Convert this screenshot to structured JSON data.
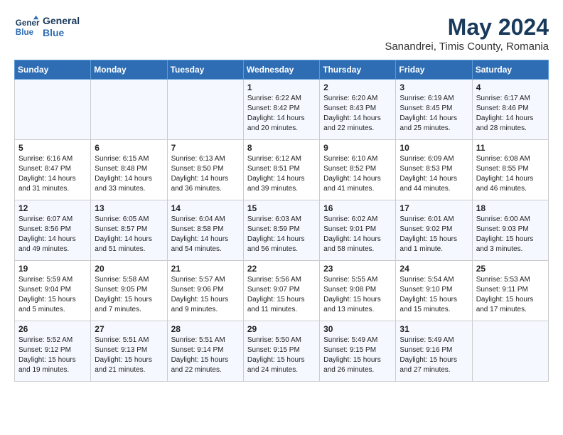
{
  "logo": {
    "line1": "General",
    "line2": "Blue"
  },
  "title": "May 2024",
  "location": "Sanandrei, Timis County, Romania",
  "weekdays": [
    "Sunday",
    "Monday",
    "Tuesday",
    "Wednesday",
    "Thursday",
    "Friday",
    "Saturday"
  ],
  "weeks": [
    [
      {
        "day": "",
        "info": ""
      },
      {
        "day": "",
        "info": ""
      },
      {
        "day": "",
        "info": ""
      },
      {
        "day": "1",
        "info": "Sunrise: 6:22 AM\nSunset: 8:42 PM\nDaylight: 14 hours\nand 20 minutes."
      },
      {
        "day": "2",
        "info": "Sunrise: 6:20 AM\nSunset: 8:43 PM\nDaylight: 14 hours\nand 22 minutes."
      },
      {
        "day": "3",
        "info": "Sunrise: 6:19 AM\nSunset: 8:45 PM\nDaylight: 14 hours\nand 25 minutes."
      },
      {
        "day": "4",
        "info": "Sunrise: 6:17 AM\nSunset: 8:46 PM\nDaylight: 14 hours\nand 28 minutes."
      }
    ],
    [
      {
        "day": "5",
        "info": "Sunrise: 6:16 AM\nSunset: 8:47 PM\nDaylight: 14 hours\nand 31 minutes."
      },
      {
        "day": "6",
        "info": "Sunrise: 6:15 AM\nSunset: 8:48 PM\nDaylight: 14 hours\nand 33 minutes."
      },
      {
        "day": "7",
        "info": "Sunrise: 6:13 AM\nSunset: 8:50 PM\nDaylight: 14 hours\nand 36 minutes."
      },
      {
        "day": "8",
        "info": "Sunrise: 6:12 AM\nSunset: 8:51 PM\nDaylight: 14 hours\nand 39 minutes."
      },
      {
        "day": "9",
        "info": "Sunrise: 6:10 AM\nSunset: 8:52 PM\nDaylight: 14 hours\nand 41 minutes."
      },
      {
        "day": "10",
        "info": "Sunrise: 6:09 AM\nSunset: 8:53 PM\nDaylight: 14 hours\nand 44 minutes."
      },
      {
        "day": "11",
        "info": "Sunrise: 6:08 AM\nSunset: 8:55 PM\nDaylight: 14 hours\nand 46 minutes."
      }
    ],
    [
      {
        "day": "12",
        "info": "Sunrise: 6:07 AM\nSunset: 8:56 PM\nDaylight: 14 hours\nand 49 minutes."
      },
      {
        "day": "13",
        "info": "Sunrise: 6:05 AM\nSunset: 8:57 PM\nDaylight: 14 hours\nand 51 minutes."
      },
      {
        "day": "14",
        "info": "Sunrise: 6:04 AM\nSunset: 8:58 PM\nDaylight: 14 hours\nand 54 minutes."
      },
      {
        "day": "15",
        "info": "Sunrise: 6:03 AM\nSunset: 8:59 PM\nDaylight: 14 hours\nand 56 minutes."
      },
      {
        "day": "16",
        "info": "Sunrise: 6:02 AM\nSunset: 9:01 PM\nDaylight: 14 hours\nand 58 minutes."
      },
      {
        "day": "17",
        "info": "Sunrise: 6:01 AM\nSunset: 9:02 PM\nDaylight: 15 hours\nand 1 minute."
      },
      {
        "day": "18",
        "info": "Sunrise: 6:00 AM\nSunset: 9:03 PM\nDaylight: 15 hours\nand 3 minutes."
      }
    ],
    [
      {
        "day": "19",
        "info": "Sunrise: 5:59 AM\nSunset: 9:04 PM\nDaylight: 15 hours\nand 5 minutes."
      },
      {
        "day": "20",
        "info": "Sunrise: 5:58 AM\nSunset: 9:05 PM\nDaylight: 15 hours\nand 7 minutes."
      },
      {
        "day": "21",
        "info": "Sunrise: 5:57 AM\nSunset: 9:06 PM\nDaylight: 15 hours\nand 9 minutes."
      },
      {
        "day": "22",
        "info": "Sunrise: 5:56 AM\nSunset: 9:07 PM\nDaylight: 15 hours\nand 11 minutes."
      },
      {
        "day": "23",
        "info": "Sunrise: 5:55 AM\nSunset: 9:08 PM\nDaylight: 15 hours\nand 13 minutes."
      },
      {
        "day": "24",
        "info": "Sunrise: 5:54 AM\nSunset: 9:10 PM\nDaylight: 15 hours\nand 15 minutes."
      },
      {
        "day": "25",
        "info": "Sunrise: 5:53 AM\nSunset: 9:11 PM\nDaylight: 15 hours\nand 17 minutes."
      }
    ],
    [
      {
        "day": "26",
        "info": "Sunrise: 5:52 AM\nSunset: 9:12 PM\nDaylight: 15 hours\nand 19 minutes."
      },
      {
        "day": "27",
        "info": "Sunrise: 5:51 AM\nSunset: 9:13 PM\nDaylight: 15 hours\nand 21 minutes."
      },
      {
        "day": "28",
        "info": "Sunrise: 5:51 AM\nSunset: 9:14 PM\nDaylight: 15 hours\nand 22 minutes."
      },
      {
        "day": "29",
        "info": "Sunrise: 5:50 AM\nSunset: 9:15 PM\nDaylight: 15 hours\nand 24 minutes."
      },
      {
        "day": "30",
        "info": "Sunrise: 5:49 AM\nSunset: 9:15 PM\nDaylight: 15 hours\nand 26 minutes."
      },
      {
        "day": "31",
        "info": "Sunrise: 5:49 AM\nSunset: 9:16 PM\nDaylight: 15 hours\nand 27 minutes."
      },
      {
        "day": "",
        "info": ""
      }
    ]
  ]
}
